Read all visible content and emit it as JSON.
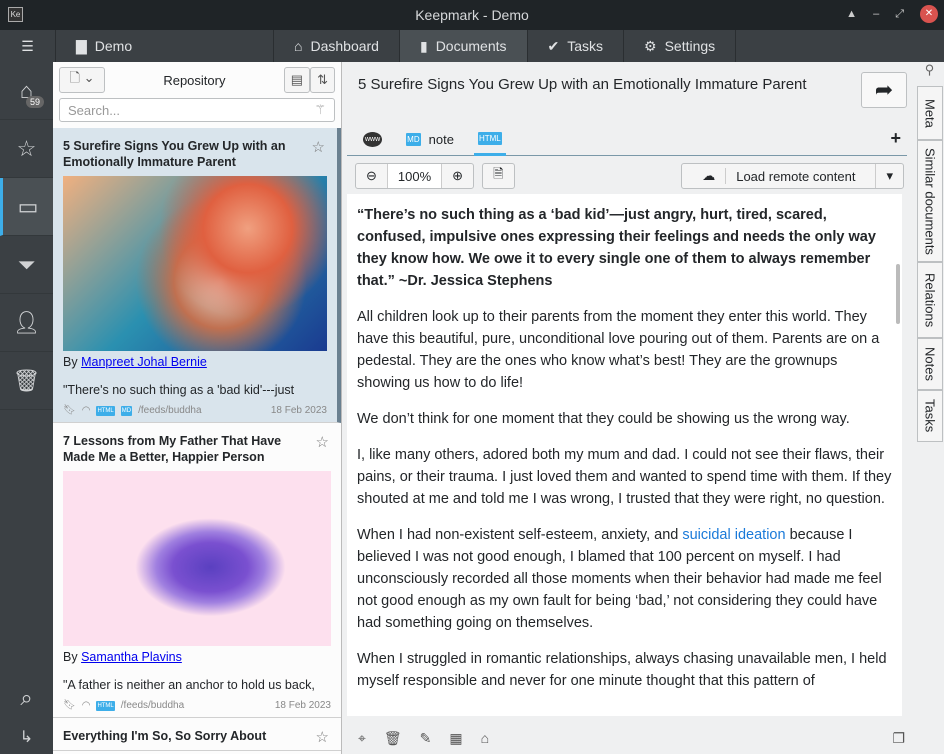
{
  "window": {
    "title": "Keepmark - Demo",
    "app_icon": "Ke"
  },
  "toolbar": {
    "menu_icon": "hamburger-icon",
    "repo": "Demo",
    "tabs": [
      {
        "label": "Dashboard",
        "icon": "home-icon"
      },
      {
        "label": "Documents",
        "icon": "documents-icon",
        "active": true
      },
      {
        "label": "Tasks",
        "icon": "check-icon"
      },
      {
        "label": "Settings",
        "icon": "gear-icon"
      }
    ]
  },
  "sidebar": {
    "inbox_count": "59",
    "items": [
      "inbox-icon",
      "star-icon",
      "folder-icon",
      "filter-icon",
      "user-icon",
      "trash-icon"
    ],
    "bottom": [
      "search-icon",
      "logout-icon"
    ]
  },
  "list": {
    "header": "Repository",
    "search_placeholder": "Search...",
    "cards": [
      {
        "title": "5 Surefire Signs You Grew Up with an Emotionally Immature Parent",
        "by": "By",
        "author": "Manpreet Johal Bernie",
        "excerpt": "\"There's no such thing as a 'bad kid'---just",
        "formats": [
          "HTML",
          "MD"
        ],
        "feed": "/feeds/buddha",
        "date": "18 Feb 2023"
      },
      {
        "title": "7 Lessons from My Father That Have Made Me a Better, Happier Person",
        "by": "By",
        "author": "Samantha Plavins",
        "excerpt": "\"A father is neither an anchor to hold us back,",
        "formats": [
          "HTML"
        ],
        "feed": "/feeds/buddha",
        "date": "18 Feb 2023"
      },
      {
        "title": "Everything I'm So, So Sorry About"
      }
    ]
  },
  "doc": {
    "title": "5 Surefire Signs You Grew Up with an Emotionally Immature Parent",
    "tabs": [
      {
        "label": "",
        "icon": "www-icon"
      },
      {
        "label": "note",
        "icon": "MD"
      },
      {
        "label": "",
        "icon": "HTML",
        "active": true
      }
    ],
    "zoom": "100%",
    "load_remote": "Load remote content",
    "quote": "“There’s no such thing as a ‘bad kid’—just angry, hurt, tired, scared, confused, impulsive ones expressing their feelings and needs the only way they know how. We owe it to every single one of them to always remember that.” ~Dr. Jessica Stephens",
    "p1": "All children look up to their parents from the moment they enter this world. They have this beautiful, pure, unconditional love pouring out of them. Parents are on a pedestal. They are the ones who know what’s best! They are the grownups showing us how to do life!",
    "p2": "We don’t think for one moment that they could be showing us the wrong way.",
    "p3": "I, like many others, adored both my mum and dad. I could not see their flaws, their pains, or their trauma. I just loved them and wanted to spend time with them. If they shouted at me and told me I was wrong, I trusted that they were right, no question.",
    "p4a": "When I had non-existent self-esteem, anxiety, and ",
    "p4link": "suicidal ideation",
    "p4b": " because I believed I was not good enough, I blamed that 100 percent on myself. I had unconsciously recorded all those moments when their behavior had made me feel not good enough as my own fault for being ‘bad,’ not considering they could have had something going on themselves.",
    "p5": "When I struggled in romantic relationships, always chasing unavailable men, I held myself responsible and never for one minute thought that this pattern of"
  },
  "right_tabs": [
    "Meta",
    "Similar documents",
    "Relations",
    "Notes",
    "Tasks"
  ],
  "colors": {
    "accent": "#3daee9",
    "titlebar": "#1f2427",
    "toolbar": "#3b4044",
    "link": "#1a7ad9"
  }
}
